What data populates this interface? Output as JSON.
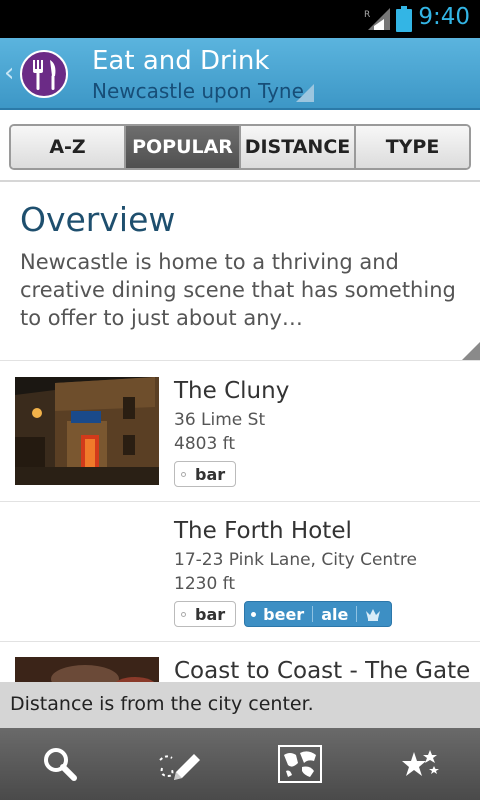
{
  "status_bar": {
    "time": "9:40",
    "signal_label": "R"
  },
  "header": {
    "title": "Eat and Drink",
    "subtitle": "Newcastle upon Tyne"
  },
  "tabs": [
    {
      "label": "A-Z"
    },
    {
      "label": "POPULAR"
    },
    {
      "label": "DISTANCE"
    },
    {
      "label": "TYPE"
    }
  ],
  "overview": {
    "title": "Overview",
    "text": "Newcastle is home to a thriving and creative dining scene that has something to offer to just about any…"
  },
  "places": [
    {
      "name": "The Cluny",
      "address": "36 Lime St",
      "distance": "4803 ft",
      "tags": [
        "bar"
      ]
    },
    {
      "name": "The Forth Hotel",
      "address": "17-23 Pink Lane, City Centre",
      "distance": "1230 ft",
      "tags": [
        "bar"
      ],
      "premium_tags": [
        "beer",
        "ale"
      ]
    },
    {
      "name": "Coast to Coast - The Gate"
    }
  ],
  "toast": {
    "text": "Distance is from the city center."
  },
  "bottom_nav": [
    {
      "icon": "search-icon"
    },
    {
      "icon": "notes-pencil-icon"
    },
    {
      "icon": "map-icon"
    },
    {
      "icon": "favorites-stars-icon"
    }
  ],
  "colors": {
    "header": "#3d97c6",
    "accent": "#33b5e5",
    "logo": "#6b2b86",
    "title_text": "#1e4f6e",
    "premium_tag": "#3d8fc4"
  }
}
